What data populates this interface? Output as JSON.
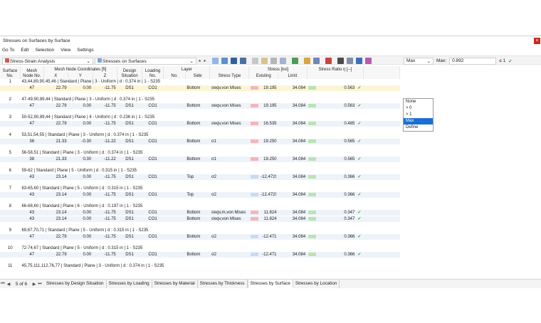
{
  "window": {
    "title": "Stresses on Surfaces by Surface",
    "close": "×"
  },
  "menu": [
    "Go To",
    "Edit",
    "Selection",
    "View",
    "Settings"
  ],
  "toolbar": {
    "analysis": "Stress-Strain Analysis",
    "result_type": "Stresses on Surfaces",
    "filter_value": "Max",
    "max_label": "Max:",
    "max_value": "0.892",
    "ratio_label": "≤ 1",
    "check": "✓"
  },
  "dropdown": {
    "options": [
      "None",
      "> 0",
      "> 1",
      "Max",
      "Define"
    ],
    "selected": "Max"
  },
  "columns": {
    "surface_no": "Surface No.",
    "mesh_node": "Mesh Node No.",
    "coords_group": "Mesh Node Coordinates [ft]",
    "x": "X",
    "y": "Y",
    "z": "Z",
    "design_situation": "Design Situation",
    "loading_no": "Loading No.",
    "layer_group": "Layer",
    "layer_no": "No.",
    "layer_side": "Side",
    "stress_type": "Stress Type",
    "stress_group": "Stress [ksi]",
    "existing": "Existing",
    "limit": "Limit",
    "ratio_group": "Stress Ratio η [--]"
  },
  "rows": [
    {
      "no": "1",
      "desc": "43,44,89,90,45,46 | Standard | Plane | 3 - Uniform | d : 0.374 in | 1 - S235",
      "items": [
        {
          "node": "47",
          "x": "22.79",
          "y": "0.00",
          "z": "-11.75",
          "ds": "DS1",
          "lc": "CO1",
          "side": "Bottom",
          "type": "σeqv,von Mises",
          "existing": "19.195",
          "limit": "34.084",
          "ratio": "0.563",
          "flag": "",
          "bar": "r"
        }
      ]
    },
    {
      "no": "2",
      "desc": "47-49,90,89,44 | Standard | Plane | 3 - Uniform | d : 0.374 in | 1 - S235",
      "items": [
        {
          "node": "47",
          "x": "22.79",
          "y": "0.00",
          "z": "-11.75",
          "ds": "DS1",
          "lc": "CO1",
          "side": "Bottom",
          "type": "σeqv,von Mises",
          "existing": "19.195",
          "limit": "34.084",
          "ratio": "0.563",
          "flag": "",
          "bar": "r"
        }
      ]
    },
    {
      "no": "3",
      "desc": "50-52,90,89,44 | Standard | Plane | 4 - Uniform | d : 0.236 in | 1 - S235",
      "items": [
        {
          "node": "47",
          "x": "22.79",
          "y": "0.00",
          "z": "-11.75",
          "ds": "DS1",
          "lc": "CO1",
          "side": "Bottom",
          "type": "σeqv,von Mises",
          "existing": "16.535",
          "limit": "34.084",
          "ratio": "0.485",
          "flag": "",
          "bar": "r"
        }
      ]
    },
    {
      "no": "4",
      "desc": "53,51,54,55 | Standard | Plane | 3 - Uniform | d : 0.374 in | 1 - S235",
      "items": [
        {
          "node": "36",
          "x": "21.33",
          "y": "-0.30",
          "z": "-11.22",
          "ds": "DS1",
          "lc": "CO1",
          "side": "Bottom",
          "type": "σ1",
          "existing": "19.250",
          "limit": "34.084",
          "ratio": "0.565",
          "flag": "",
          "bar": "r"
        }
      ]
    },
    {
      "no": "5",
      "desc": "56-58,51 | Standard | Plane | 3 - Uniform | d : 0.374 in | 1 - S235",
      "items": [
        {
          "node": "38",
          "x": "21.33",
          "y": "0.30",
          "z": "-11.22",
          "ds": "DS1",
          "lc": "CO1",
          "side": "Bottom",
          "type": "σ1",
          "existing": "19.250",
          "limit": "34.084",
          "ratio": "0.565",
          "flag": "",
          "bar": "r"
        }
      ]
    },
    {
      "no": "6",
      "desc": "59-62 | Standard | Plane | 5 - Uniform | d : 0.315 in | 1 - S235",
      "items": [
        {
          "node": "43",
          "x": "23.14",
          "y": "0.00",
          "z": "-11.75",
          "ds": "DS1",
          "lc": "CO1",
          "side": "Top",
          "type": "σ2",
          "existing": "-12.472",
          "limit": "34.084",
          "ratio": "0.366",
          "flag": "!",
          "bar": "b"
        }
      ]
    },
    {
      "no": "7",
      "desc": "63-65,60 | Standard | Plane | 5 - Uniform | d : 0.315 in | 1 - S235",
      "items": [
        {
          "node": "43",
          "x": "23.14",
          "y": "0.00",
          "z": "-11.75",
          "ds": "DS1",
          "lc": "CO1",
          "side": "Top",
          "type": "σ2",
          "existing": "-12.472",
          "limit": "34.084",
          "ratio": "0.366",
          "flag": "!",
          "bar": "b"
        }
      ]
    },
    {
      "no": "8",
      "desc": "66-68,60 | Standard | Plane | 6 - Uniform | d : 0.197 in | 1 - S235",
      "items": [
        {
          "node": "43",
          "x": "23.14",
          "y": "0.00",
          "z": "-11.75",
          "ds": "DS1",
          "lc": "CO1",
          "side": "Bottom",
          "type": "σeqv,m,von Mises",
          "existing": "11.824",
          "limit": "34.084",
          "ratio": "0.347",
          "flag": "",
          "bar": "r"
        },
        {
          "node": "43",
          "x": "23.14",
          "y": "0.00",
          "z": "-11.75",
          "ds": "DS1",
          "lc": "CO1",
          "side": "Bottom",
          "type": "σeqv,von Mises",
          "existing": "11.824",
          "limit": "34.084",
          "ratio": "0.347",
          "flag": "",
          "bar": "r"
        }
      ]
    },
    {
      "no": "9",
      "desc": "69,67,70,71 | Standard | Plane | 5 - Uniform | d : 0.315 in | 1 - S235",
      "items": [
        {
          "node": "47",
          "x": "22.79",
          "y": "0.00",
          "z": "-11.75",
          "ds": "DS1",
          "lc": "CO1",
          "side": "Bottom",
          "type": "σ2",
          "existing": "-12.471",
          "limit": "34.084",
          "ratio": "0.366",
          "flag": "",
          "bar": "b"
        }
      ]
    },
    {
      "no": "10",
      "desc": "72-74,67 | Standard | Plane | 5 - Uniform | d : 0.315 in | 1 - S235",
      "items": [
        {
          "node": "47",
          "x": "22.79",
          "y": "0.00",
          "z": "-11.75",
          "ds": "DS1",
          "lc": "CO1",
          "side": "Bottom",
          "type": "σ2",
          "existing": "-12.471",
          "limit": "34.084",
          "ratio": "0.366",
          "flag": "",
          "bar": "b"
        }
      ]
    },
    {
      "no": "11",
      "desc": "45,75,111,112,76,77 | Standard | Plane | 3 - Uniform | d : 0.374 in | 1 - S235",
      "items": []
    }
  ],
  "pager": {
    "first": "⏮",
    "prev": "◀",
    "label": "5 of 6",
    "next": "▶",
    "last": "⏭"
  },
  "tabs": [
    "Stresses by Design Situation",
    "Stresses by Loading",
    "Stresses by Material",
    "Stresses by Thickness",
    "Stresses by Surface",
    "Stresses by Location"
  ],
  "active_tab": "Stresses by Surface",
  "colors": {
    "accent": "#1c6fd1",
    "selected_row": "#fbf5d5",
    "data_row": "#eef3f9",
    "close": "#c42b1c",
    "ok": "#2e8b2e"
  }
}
